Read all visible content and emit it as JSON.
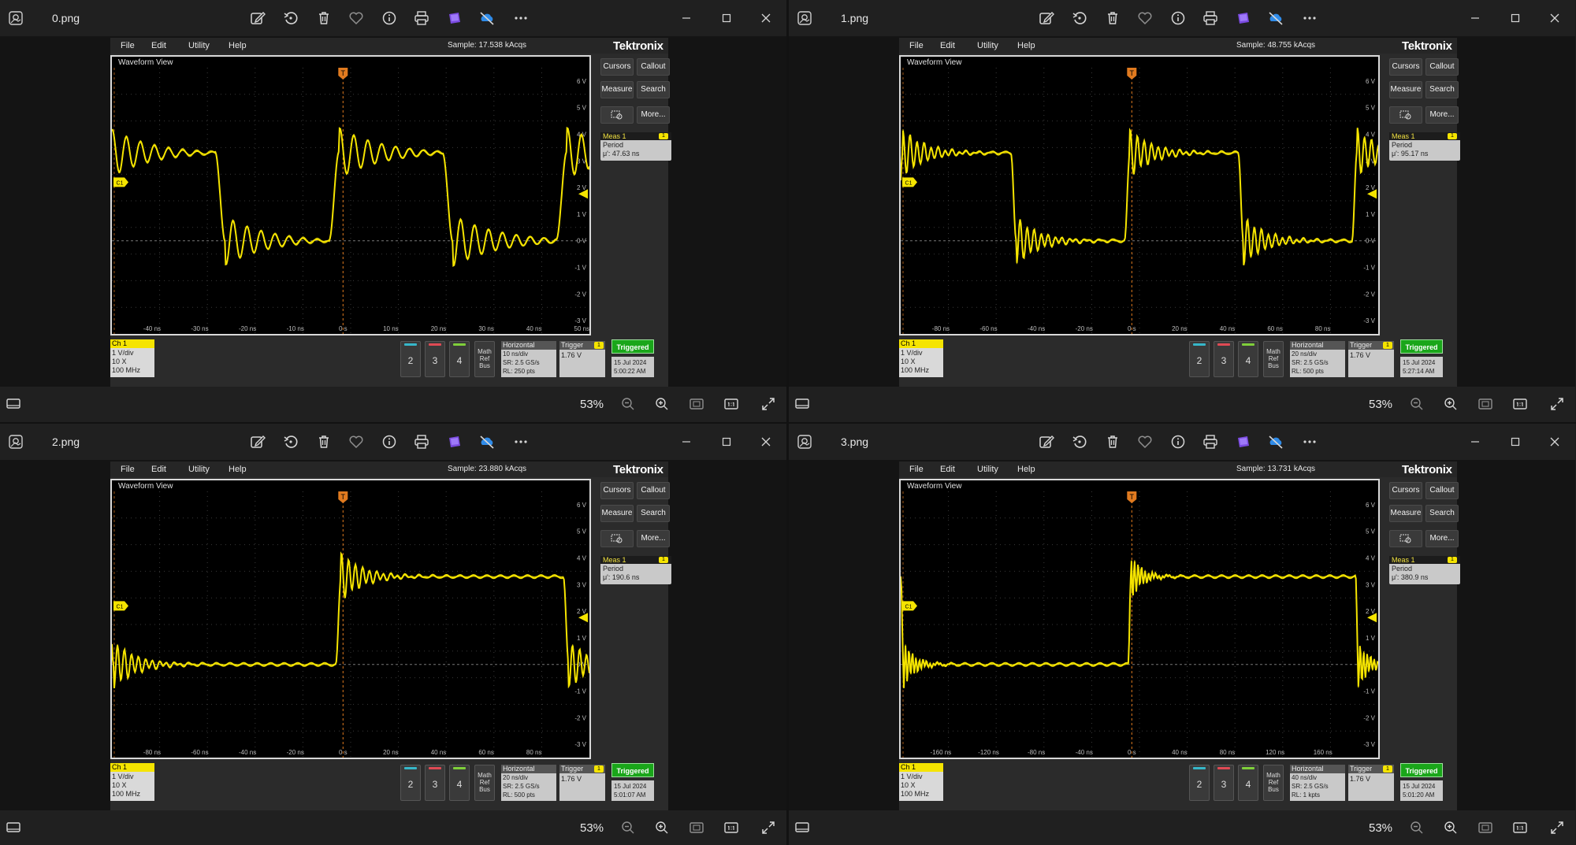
{
  "windows": [
    {
      "file_name": "0.png",
      "sample_text": "Sample: 17.538 kAcqs",
      "meas_value": "μ': 47.63 ns",
      "horizontal": {
        "scale": "10 ns/div",
        "sample_rate": "SR: 2.5 GS/s",
        "record_length": "RL: 250 pts"
      },
      "time": "5:00:22 AM",
      "x_ticks": [
        "-40 ns",
        "-30 ns",
        "-20 ns",
        "-10 ns",
        "0 s",
        "10 ns",
        "20 ns",
        "30 ns",
        "40 ns",
        "50 ns"
      ],
      "chart_data": {
        "type": "line",
        "xlim": [
          -48.4,
          51.6
        ],
        "ylim": [
          -3.5,
          6.5
        ],
        "period_ns": 47.63,
        "shape": "ringing-square",
        "x_unit": "ns",
        "y_unit": "V"
      }
    },
    {
      "file_name": "1.png",
      "sample_text": "Sample: 48.755 kAcqs",
      "meas_value": "μ': 95.17 ns",
      "horizontal": {
        "scale": "20 ns/div",
        "sample_rate": "SR: 2.5 GS/s",
        "record_length": "RL: 500 pts"
      },
      "time": "5:27:14 AM",
      "x_ticks": [
        "-80 ns",
        "-60 ns",
        "-40 ns",
        "-20 ns",
        "0 s",
        "20 ns",
        "40 ns",
        "60 ns",
        "80 ns"
      ],
      "chart_data": {
        "type": "line",
        "xlim": [
          -96.8,
          103.2
        ],
        "ylim": [
          -3.5,
          6.5
        ],
        "period_ns": 95.17,
        "shape": "ringing-square",
        "x_unit": "ns",
        "y_unit": "V"
      }
    },
    {
      "file_name": "2.png",
      "sample_text": "Sample: 23.880 kAcqs",
      "meas_value": "μ': 190.6 ns",
      "horizontal": {
        "scale": "20 ns/div",
        "sample_rate": "SR: 2.5 GS/s",
        "record_length": "RL: 500 pts"
      },
      "time": "5:01:07 AM",
      "x_ticks": [
        "-80 ns",
        "-60 ns",
        "-40 ns",
        "-20 ns",
        "0 s",
        "20 ns",
        "40 ns",
        "60 ns",
        "80 ns"
      ],
      "chart_data": {
        "type": "line",
        "xlim": [
          -96.8,
          103.2
        ],
        "ylim": [
          -3.5,
          6.5
        ],
        "period_ns": 190.6,
        "shape": "ringing-square",
        "x_unit": "ns",
        "y_unit": "V"
      }
    },
    {
      "file_name": "3.png",
      "sample_text": "Sample: 13.731 kAcqs",
      "meas_value": "μ': 380.9 ns",
      "horizontal": {
        "scale": "40 ns/div",
        "sample_rate": "SR: 2.5 GS/s",
        "record_length": "RL: 1 kpts"
      },
      "time": "5:01:20 AM",
      "x_ticks": [
        "-160 ns",
        "-120 ns",
        "-80 ns",
        "-40 ns",
        "0 s",
        "40 ns",
        "80 ns",
        "120 ns",
        "160 ns"
      ],
      "chart_data": {
        "type": "line",
        "xlim": [
          -193.6,
          206.4
        ],
        "ylim": [
          -3.5,
          6.5
        ],
        "period_ns": 380.9,
        "shape": "ringing-square",
        "x_unit": "ns",
        "y_unit": "V"
      }
    }
  ],
  "common": {
    "zoom": "53%",
    "menus": [
      "File",
      "Edit",
      "Utility",
      "Help"
    ],
    "brand": "Tektronix",
    "waveform_view": "Waveform View",
    "buttons": {
      "cursors": "Cursors",
      "callout": "Callout",
      "measure": "Measure",
      "search": "Search",
      "more": "More..."
    },
    "meas": {
      "title": "Meas 1",
      "badge": "1",
      "label": "Period"
    },
    "ch1": {
      "title": "Ch 1",
      "scale": "1 V/div",
      "probe": "10 X",
      "bw": "100 MHz"
    },
    "channels": [
      "2",
      "3",
      "4"
    ],
    "channel_colors": [
      "#36b7c9",
      "#e04a54",
      "#7fcf3a"
    ],
    "math_ref_bus": [
      "Math",
      "Ref",
      "Bus"
    ],
    "horizontal_title": "Horizontal",
    "trigger": {
      "title": "Trigger",
      "badge": "1",
      "level": "1.76 V"
    },
    "triggered": "Triggered",
    "date": "15 Jul 2024",
    "y_ticks": [
      "6 V",
      "5 V",
      "4 V",
      "3 V",
      "2 V",
      "1 V",
      "0 V",
      "-1 V",
      "-2 V",
      "-3 V"
    ],
    "ch_marker": "C1",
    "trig_marker": "T",
    "trace_color": "#f5e400"
  }
}
